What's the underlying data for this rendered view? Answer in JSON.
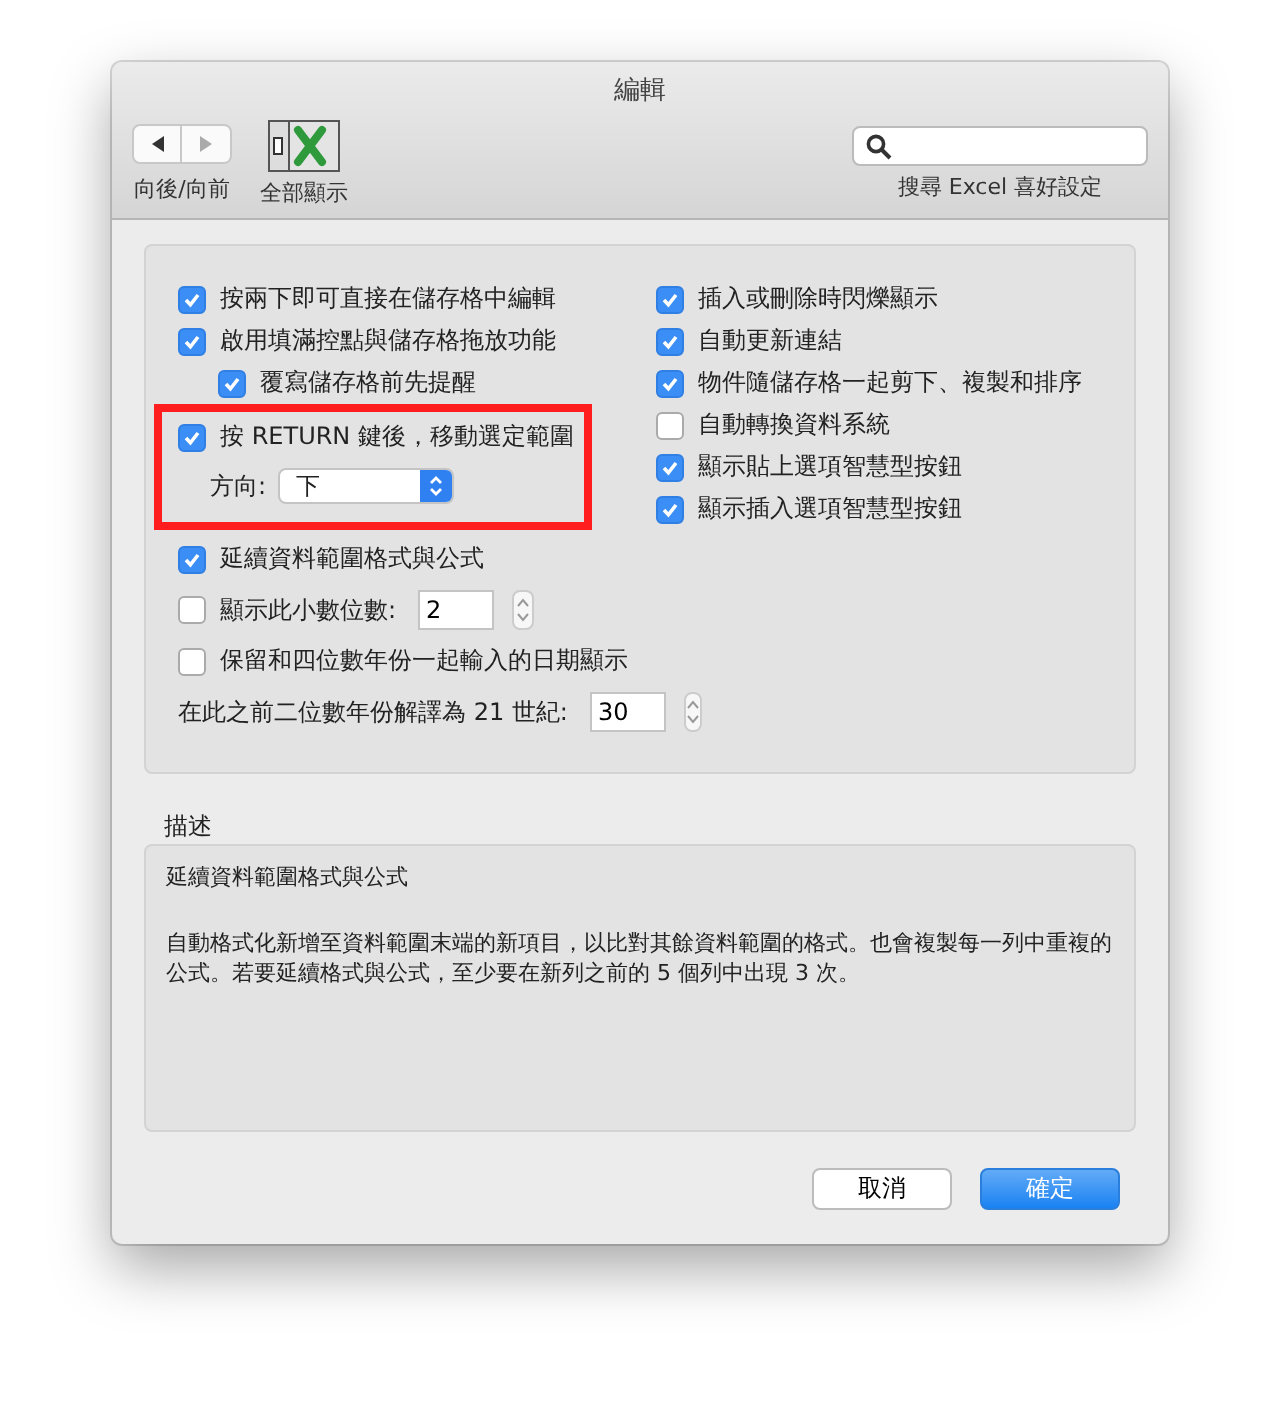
{
  "window": {
    "title": "編輯"
  },
  "toolbar": {
    "nav_label": "向後/向前",
    "show_all_label": "全部顯示",
    "search": {
      "caption": "搜尋 Excel 喜好設定"
    }
  },
  "left_options": [
    {
      "kind": "checkbox",
      "label": "按兩下即可直接在儲存格中編輯",
      "checked": true
    },
    {
      "kind": "checkbox",
      "label": "啟用填滿控點與儲存格拖放功能",
      "checked": true,
      "children": [
        {
          "label": "覆寫儲存格前先提醒",
          "checked": true
        }
      ]
    },
    {
      "kind": "checkbox",
      "label": "按 RETURN 鍵後，移動選定範圍",
      "checked": true,
      "highlighted": true,
      "select": {
        "label": "方向:",
        "value": "下"
      }
    },
    {
      "kind": "checkbox",
      "label": "延續資料範圍格式與公式",
      "checked": true
    },
    {
      "kind": "checkbox",
      "label": "顯示此小數位數:",
      "checked": false,
      "stepper": {
        "value": "2"
      }
    },
    {
      "kind": "checkbox",
      "label": "保留和四位數年份一起輸入的日期顯示",
      "checked": false
    },
    {
      "kind": "number",
      "label": "在此之前二位數年份解譯為 21 世紀:",
      "stepper": {
        "value": "30"
      }
    }
  ],
  "right_options": [
    {
      "label": "插入或刪除時閃爍顯示",
      "checked": true
    },
    {
      "label": "自動更新連結",
      "checked": true
    },
    {
      "label": "物件隨儲存格一起剪下、複製和排序",
      "checked": true
    },
    {
      "label": "自動轉換資料系統",
      "checked": false
    },
    {
      "label": "顯示貼上選項智慧型按鈕",
      "checked": true
    },
    {
      "label": "顯示插入選項智慧型按鈕",
      "checked": true
    }
  ],
  "description": {
    "heading": "描述",
    "title": "延續資料範圍格式與公式",
    "text": "自動格式化新增至資料範圍末端的新項目，以比對其餘資料範圍的格式。也會複製每一列中重複的公式。若要延續格式與公式，至少要在新列之前的 5 個列中出現 3 次。"
  },
  "buttons": [
    {
      "label": "取消",
      "kind": "secondary"
    },
    {
      "label": "確定",
      "kind": "primary"
    }
  ]
}
